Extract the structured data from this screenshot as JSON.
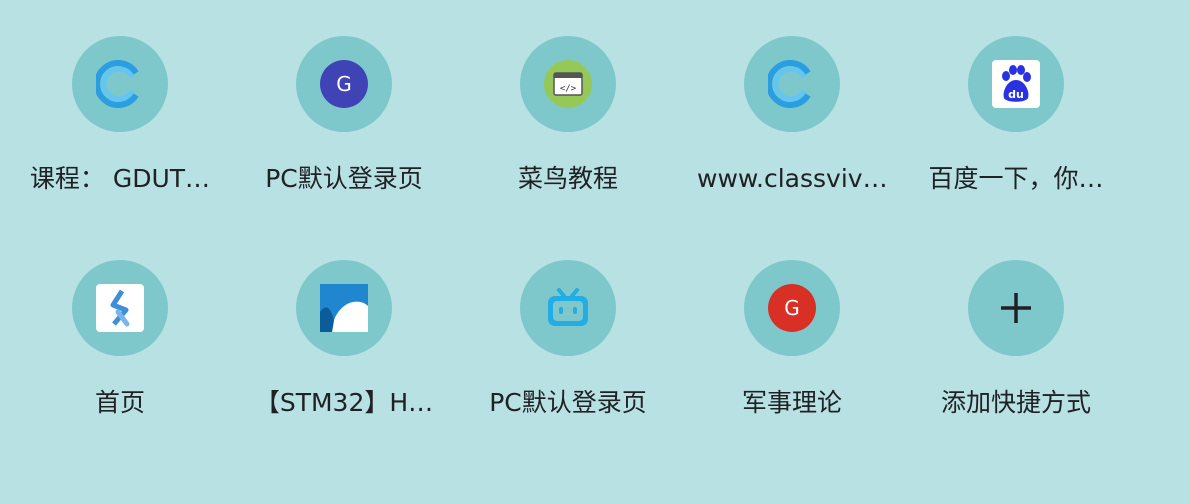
{
  "shortcuts": [
    {
      "label": "课程： GDUT…",
      "icon": "classviva-c-icon"
    },
    {
      "label": "PC默认登录页",
      "icon": "g-letter-icon",
      "color": "#3f43b5"
    },
    {
      "label": "菜鸟教程",
      "icon": "runoob-code-icon"
    },
    {
      "label": "www.classviv…",
      "icon": "classviva-c-icon"
    },
    {
      "label": "百度一下，你…",
      "icon": "baidu-paw-icon"
    },
    {
      "label": "首页",
      "icon": "juejin-logo-icon"
    },
    {
      "label": "【STM32】H…",
      "icon": "blue-arc-icon"
    },
    {
      "label": "PC默认登录页",
      "icon": "bilibili-tv-icon"
    },
    {
      "label": "军事理论",
      "icon": "g-letter-icon",
      "color": "#d93025"
    },
    {
      "label": "添加快捷方式",
      "icon": "plus-icon"
    }
  ]
}
